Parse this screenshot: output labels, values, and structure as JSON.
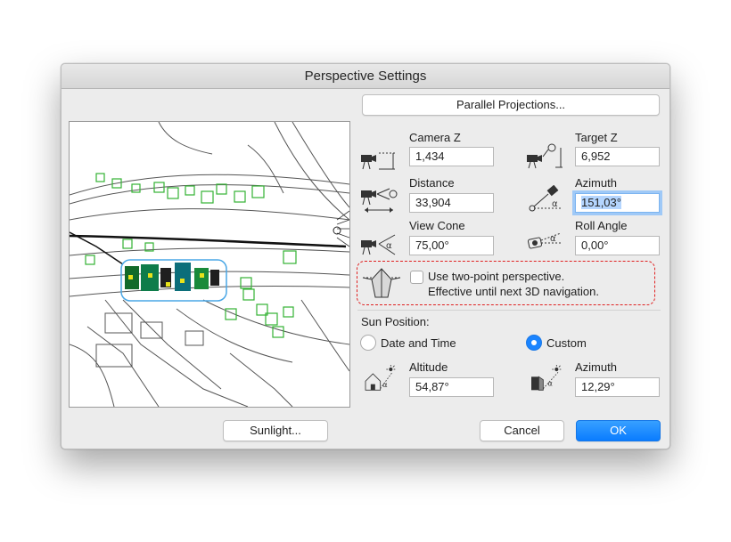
{
  "dialog": {
    "title": "Perspective Settings",
    "parallel_projections_label": "Parallel Projections...",
    "sunlight_label": "Sunlight...",
    "cancel_label": "Cancel",
    "ok_label": "OK"
  },
  "fields": {
    "camera_z": {
      "label": "Camera Z",
      "value": "1,434",
      "icon": "camera-height-icon"
    },
    "target_z": {
      "label": "Target Z",
      "value": "6,952",
      "icon": "target-height-icon"
    },
    "distance": {
      "label": "Distance",
      "value": "33,904",
      "icon": "camera-distance-icon"
    },
    "azimuth": {
      "label": "Azimuth",
      "value": "151,03°",
      "icon": "camera-azimuth-icon"
    },
    "view_cone": {
      "label": "View Cone",
      "value": "75,00°",
      "icon": "view-cone-icon"
    },
    "roll_angle": {
      "label": "Roll Angle",
      "value": "0,00°",
      "icon": "roll-angle-icon"
    }
  },
  "two_point": {
    "line1": "Use two-point perspective.",
    "line2": "Effective until next 3D navigation.",
    "checked": false,
    "icon": "two-point-perspective-icon"
  },
  "sun": {
    "section_label": "Sun Position:",
    "date_time_label": "Date and Time",
    "custom_label": "Custom",
    "selected": "custom",
    "altitude": {
      "label": "Altitude",
      "value": "54,87°",
      "icon": "sun-altitude-icon"
    },
    "azimuth": {
      "label": "Azimuth",
      "value": "12,29°",
      "icon": "sun-azimuth-icon"
    }
  },
  "colors": {
    "accent": "#1a84ff",
    "highlight_annotation": "#e02020",
    "tree_symbols": "#33b233"
  }
}
